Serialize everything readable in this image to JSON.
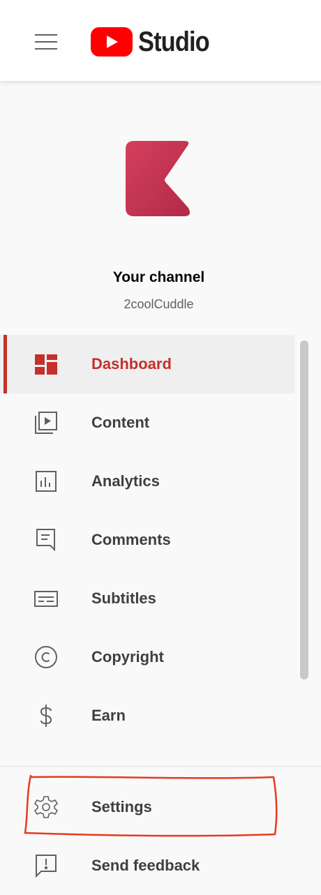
{
  "app": {
    "logo_text": "Studio"
  },
  "channel": {
    "title": "Your channel",
    "name": "2coolCuddle"
  },
  "nav": {
    "items": [
      {
        "label": "Dashboard",
        "icon": "dashboard-icon",
        "active": true
      },
      {
        "label": "Content",
        "icon": "content-icon",
        "active": false
      },
      {
        "label": "Analytics",
        "icon": "analytics-icon",
        "active": false
      },
      {
        "label": "Comments",
        "icon": "comments-icon",
        "active": false
      },
      {
        "label": "Subtitles",
        "icon": "subtitles-icon",
        "active": false
      },
      {
        "label": "Copyright",
        "icon": "copyright-icon",
        "active": false
      },
      {
        "label": "Earn",
        "icon": "dollar-icon",
        "active": false
      }
    ]
  },
  "bottom_nav": {
    "settings_label": "Settings",
    "feedback_label": "Send feedback"
  },
  "colors": {
    "accent": "#c4302b",
    "brand_red": "#ff0000",
    "annotation": "#e8391e"
  }
}
